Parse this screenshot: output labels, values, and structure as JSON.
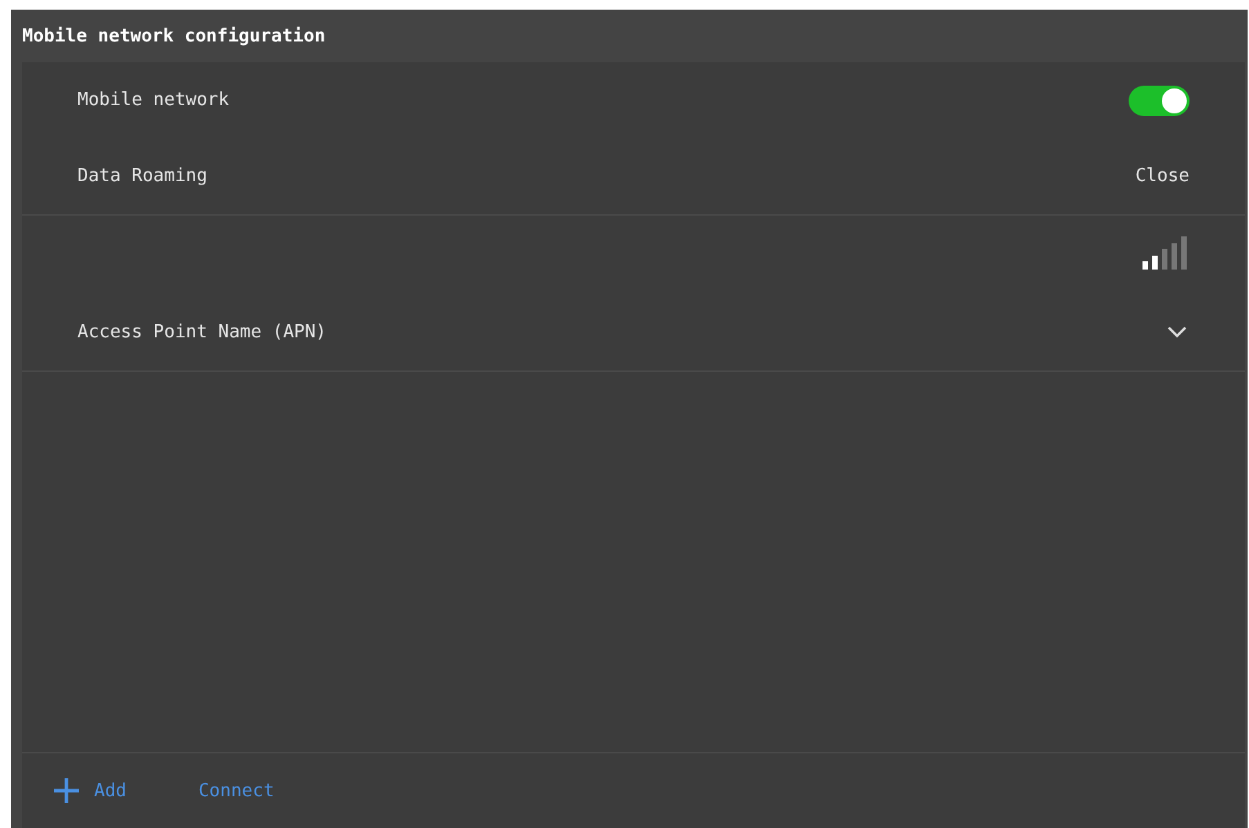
{
  "window": {
    "title": "Mobile network configuration"
  },
  "settings": [
    {
      "kind": "toggle",
      "label": "Mobile network",
      "on": true
    },
    {
      "kind": "value",
      "label": "Data Roaming",
      "value": "Close"
    }
  ],
  "network": {
    "kind": "signal"
  },
  "apn": {
    "label": "Access Point Name (APN)",
    "expanded": false
  },
  "footer": {
    "add_label": "Add",
    "connect_label": "Connect"
  }
}
